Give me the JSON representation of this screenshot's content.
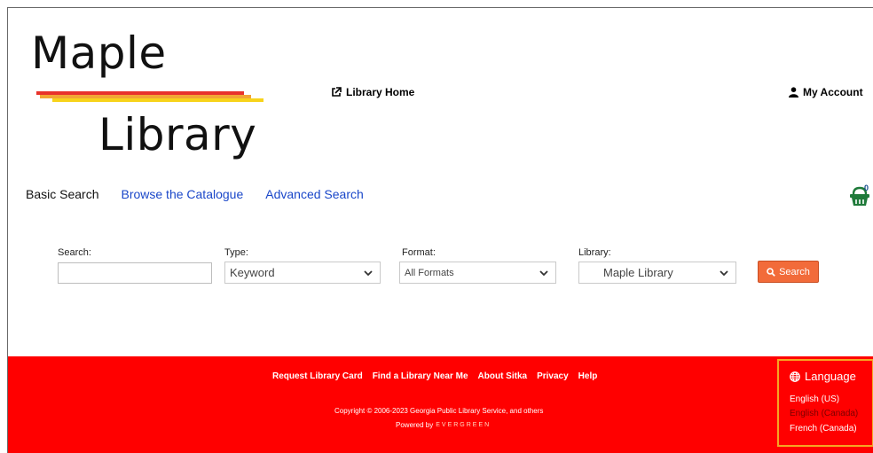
{
  "logo": {
    "line1": "Maple",
    "line2": "Library"
  },
  "header": {
    "library_home": "Library Home",
    "my_account": "My Account"
  },
  "nav": {
    "basic_search": "Basic Search",
    "browse": "Browse the Catalogue",
    "advanced": "Advanced Search"
  },
  "cart": {
    "count": "0",
    "icon": "basket-icon"
  },
  "search_form": {
    "search_label": "Search:",
    "search_value": "",
    "type_label": "Type:",
    "type_value": "Keyword",
    "format_label": "Format:",
    "format_value": "All Formats",
    "library_label": "Library:",
    "library_value": "Maple Library",
    "search_button": "Search"
  },
  "footer": {
    "links": [
      "Request Library Card",
      "Find a Library Near Me",
      "About Sitka",
      "Privacy",
      "Help"
    ],
    "copyright": "Copyright © 2006-2023 Georgia Public Library Service, and others",
    "powered_by": "Powered by",
    "evergreen": "EVERGREEN"
  },
  "language": {
    "heading": "Language",
    "options": [
      "English (US)",
      "English (Canada)",
      "French (Canada)"
    ]
  },
  "colors": {
    "footer_bg": "#ff0000",
    "search_button": "#f26b3a",
    "nav_link": "#1a47c9",
    "lang_border": "#f5a623"
  }
}
